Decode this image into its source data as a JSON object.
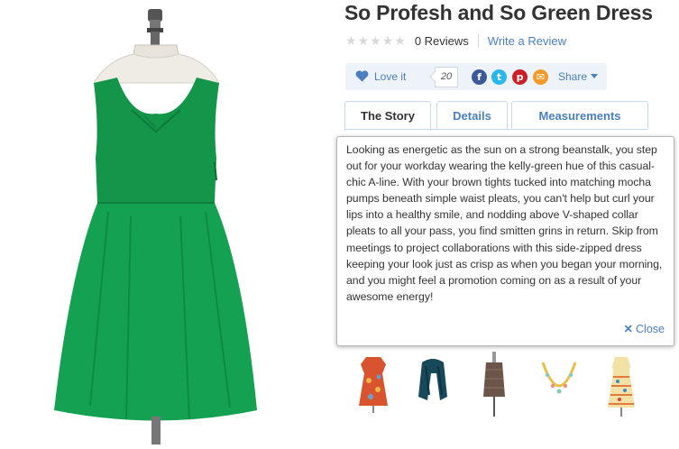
{
  "product": {
    "title": "So Profesh and So Green Dress",
    "image_icon": "green-dress-on-mannequin",
    "rating_stars": 0,
    "reviews_label": "0 Reviews",
    "write_review_label": "Write a Review"
  },
  "social": {
    "love_label": "Love it",
    "love_count": "20",
    "icons": [
      "facebook-icon",
      "twitter-icon",
      "pinterest-icon",
      "email-icon"
    ],
    "share_label": "Share"
  },
  "tabs": [
    {
      "label": "The Story",
      "active": true
    },
    {
      "label": "Details",
      "active": false
    },
    {
      "label": "Measurements",
      "active": false
    }
  ],
  "story": {
    "text": "Looking as energetic as the sun on a strong beanstalk, you step out for your workday wearing the kelly-green hue of this casual-chic A-line. With your brown tights tucked into matching mocha pumps beneath simple waist pleats, you can't help but curl your lips into a healthy smile, and nodding above V-shaped collar pleats to all your pass, you find smitten grins in return. Skip from meetings to project collaborations with this side-zipped dress keeping your look just as crisp as when you began your morning, and you might feel a promotion coming on as a result of your awesome energy!",
    "close_label": "Close"
  },
  "related_items": [
    "orange-print-dress",
    "teal-scarf",
    "tweed-skirt",
    "bead-necklace",
    "printed-dress"
  ],
  "colors": {
    "accent": "#4a7fc1",
    "dress": "#13954a"
  }
}
